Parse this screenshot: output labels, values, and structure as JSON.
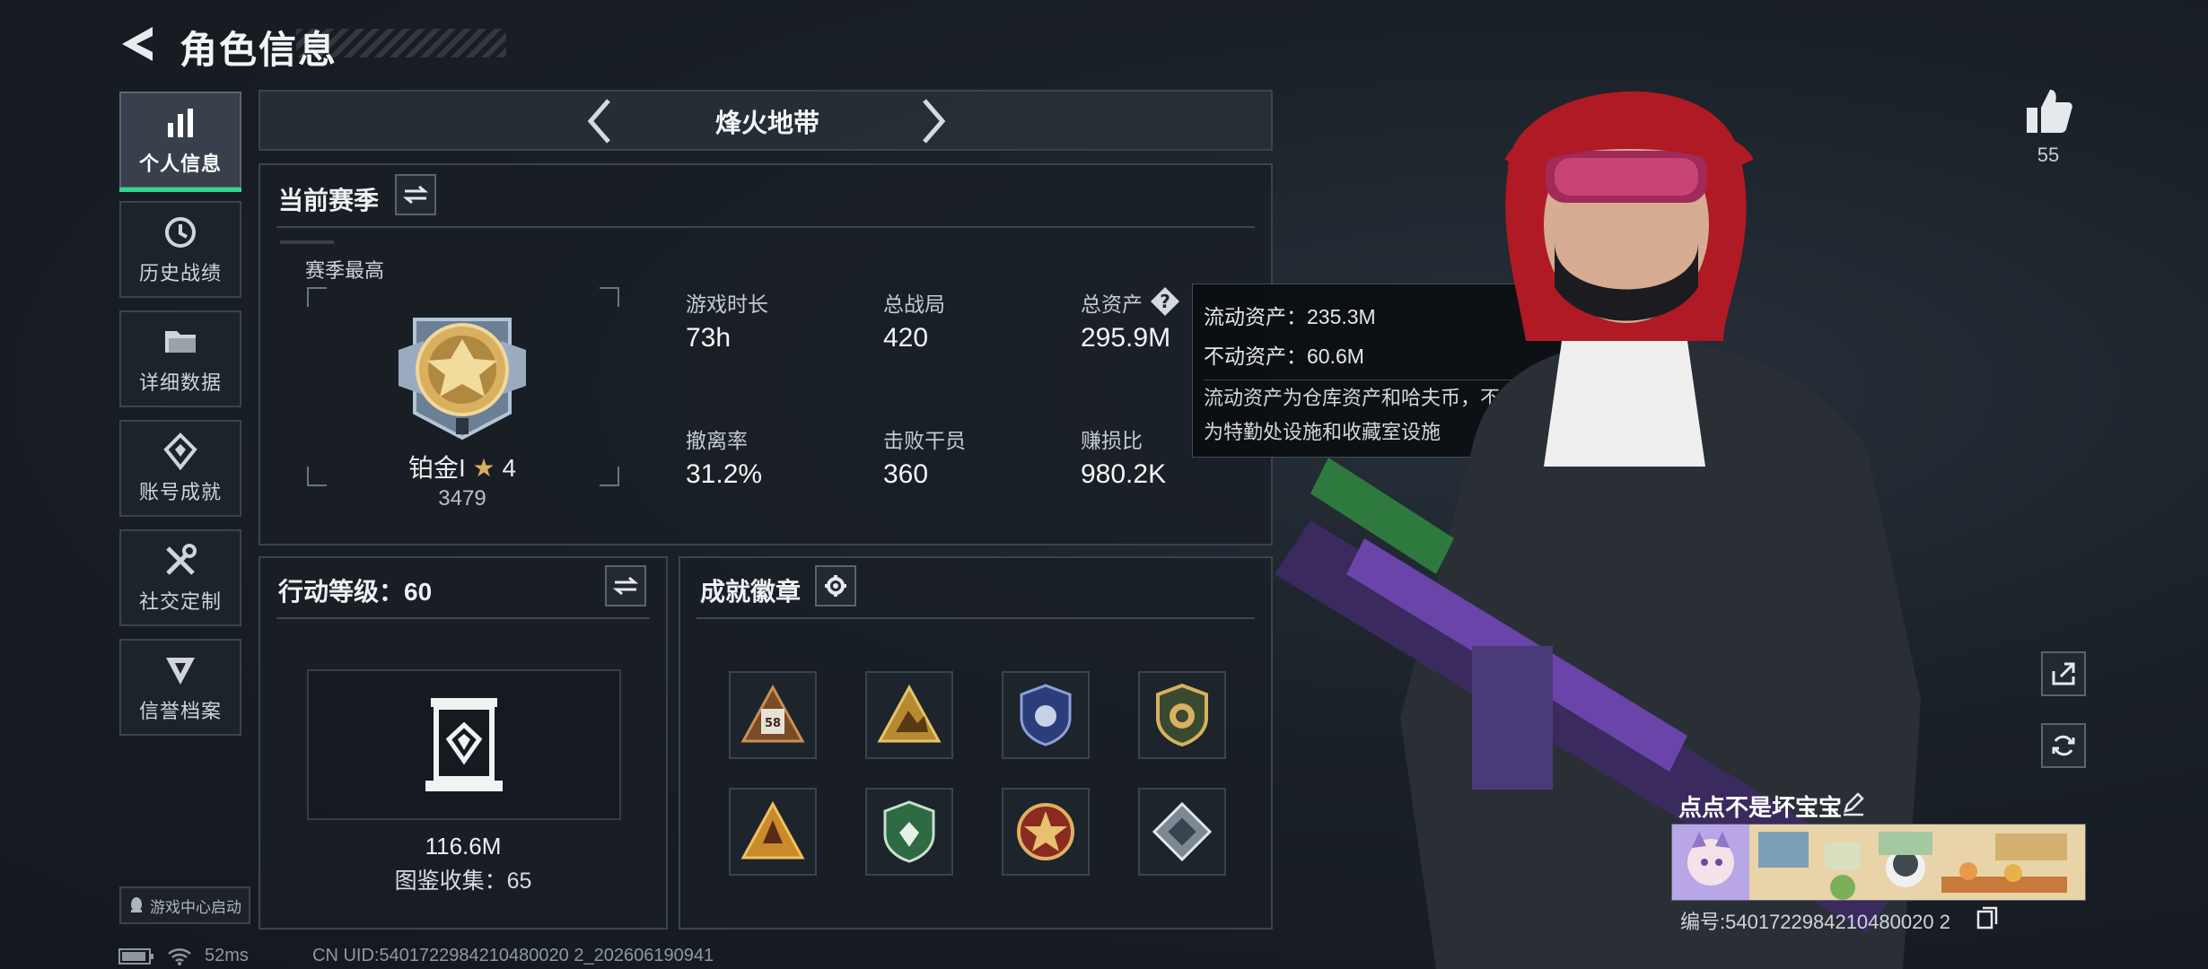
{
  "header": {
    "title": "角色信息",
    "back_icon": "back-arrow-icon"
  },
  "sidebar": {
    "items": [
      {
        "label": "个人信息",
        "icon": "bar-chart-icon",
        "active": true
      },
      {
        "label": "历史战绩",
        "icon": "clock-history-icon",
        "active": false
      },
      {
        "label": "详细数据",
        "icon": "folder-icon",
        "active": false
      },
      {
        "label": "账号成就",
        "icon": "achievement-icon",
        "active": false
      },
      {
        "label": "社交定制",
        "icon": "tools-icon",
        "active": false
      },
      {
        "label": "信誉档案",
        "icon": "credit-badge-icon",
        "active": false
      }
    ],
    "game_center": "游戏中心启动"
  },
  "mode": {
    "title": "烽火地带"
  },
  "season": {
    "title": "当前赛季",
    "best_label": "赛季最高",
    "rank_name": "铂金I",
    "rank_stars": "4",
    "rank_score": "3479",
    "stats": [
      {
        "label": "游戏时长",
        "value": "73h"
      },
      {
        "label": "总战局",
        "value": "420"
      },
      {
        "label": "总资产",
        "value": "295.9M"
      },
      {
        "label": "撤离率",
        "value": "31.2%"
      },
      {
        "label": "击败干员",
        "value": "360"
      },
      {
        "label": "赚损比",
        "value": "980.2K"
      }
    ]
  },
  "tooltip": {
    "liquid": "流动资产：235.3M",
    "fixed": "不动资产：60.6M",
    "desc_line1": "流动资产为仓库资产和哈夫币，不动资产",
    "desc_line2": "为特勤处设施和收藏室设施"
  },
  "level": {
    "title": "行动等级：60",
    "value": "116.6M",
    "collection": "图鉴收集：65"
  },
  "badges": {
    "title": "成就徽章",
    "items": [
      "badge-58",
      "badge-yellow-triangle",
      "badge-police-shield",
      "badge-gold-emblem",
      "badge-orange-triangle",
      "badge-green-shield",
      "badge-red-star",
      "badge-silver-diamond"
    ]
  },
  "status": {
    "latency": "52ms",
    "uid": "CN UID:5401722984210480020 2_202606190941"
  },
  "profile": {
    "likes": "55",
    "player_name": "点点不是坏宝宝",
    "player_id": "编号:5401722984210480020 2"
  },
  "colors": {
    "accent_green": "#2fd890",
    "gold": "#d8b060"
  }
}
